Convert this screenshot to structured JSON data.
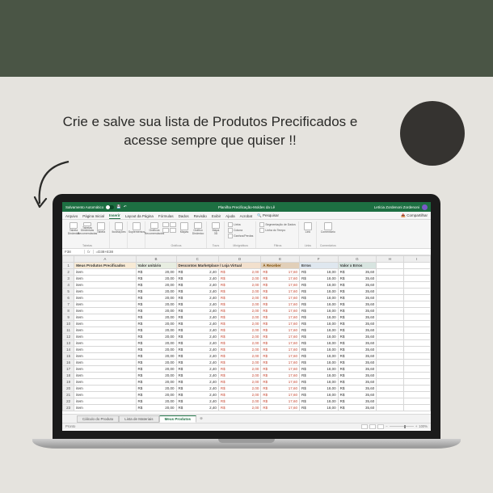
{
  "promo": {
    "line1": "Crie e salve sua lista de Produtos Precificados e",
    "line2": "acesse sempre que quiser !!"
  },
  "excel": {
    "autosave_label": "Salvamento Automático",
    "doc_title": "Planilha Precificação-Moldes da Lê",
    "user_name": "Letícia Zordenoni Zordenoni",
    "share_label": "Compartilhar",
    "search_placeholder": "Pesquisar",
    "menu": [
      "Arquivo",
      "Página Inicial",
      "Inserir",
      "Layout da Página",
      "Fórmulas",
      "Dados",
      "Revisão",
      "Exibir",
      "Ajuda",
      "Acrobat"
    ],
    "menu_active": "Inserir",
    "ribbon_groups": {
      "g1": {
        "items": [
          "Tabela Dinâmica",
          "Tabelas Dinâmicas Recomendadas",
          "Tabela"
        ],
        "title": "Tabelas"
      },
      "g2": {
        "items": [
          "Ilustrações"
        ],
        "title": ""
      },
      "g3": {
        "items": [
          "Suplementos"
        ],
        "title": ""
      },
      "g4": {
        "items": [
          "Gráficos Recomendados",
          "",
          "Mapas",
          "Gráfico Dinâmico"
        ],
        "title": "Gráficos"
      },
      "g5": {
        "items": [
          "Mapa 3D"
        ],
        "title": "Tours"
      },
      "g6": {
        "items": [
          "Linha",
          "Coluna",
          "Ganhos/Perdas"
        ],
        "title": "Minigráficos"
      },
      "g7": {
        "items": [
          "Segmentação de Dados",
          "Linha do Tempo"
        ],
        "title": "Filtros"
      },
      "g8": {
        "items": [
          "Link"
        ],
        "title": "Links"
      },
      "g9": {
        "items": [
          "Comentário"
        ],
        "title": "Comentários"
      }
    },
    "name_box": "F38",
    "formula": "=D38+E38",
    "col_letters": [
      "A",
      "B",
      "C",
      "D",
      "E",
      "F",
      "G",
      "H",
      "I"
    ],
    "titles": {
      "A": "Meus Produtos Precificados",
      "B": "Valor unitário",
      "C": "Descontos Marketplace / Loja Virtual",
      "E": "À Receber",
      "F": "Erros",
      "G": "Valor x Erros"
    },
    "row": {
      "item": "item",
      "rs": "R$",
      "b": "20,00",
      "c": "2,40",
      "d": "2,00",
      "e": "17,60",
      "f": "18,00",
      "g": "35,60"
    },
    "row_start": 2,
    "row_end": 23,
    "sheet_tabs": [
      "Cálculo do Produto",
      "Lista de Materiais",
      "Meus Produtos"
    ],
    "sheet_active": "Meus Produtos",
    "status": "Pronto",
    "zoom": "100%"
  }
}
